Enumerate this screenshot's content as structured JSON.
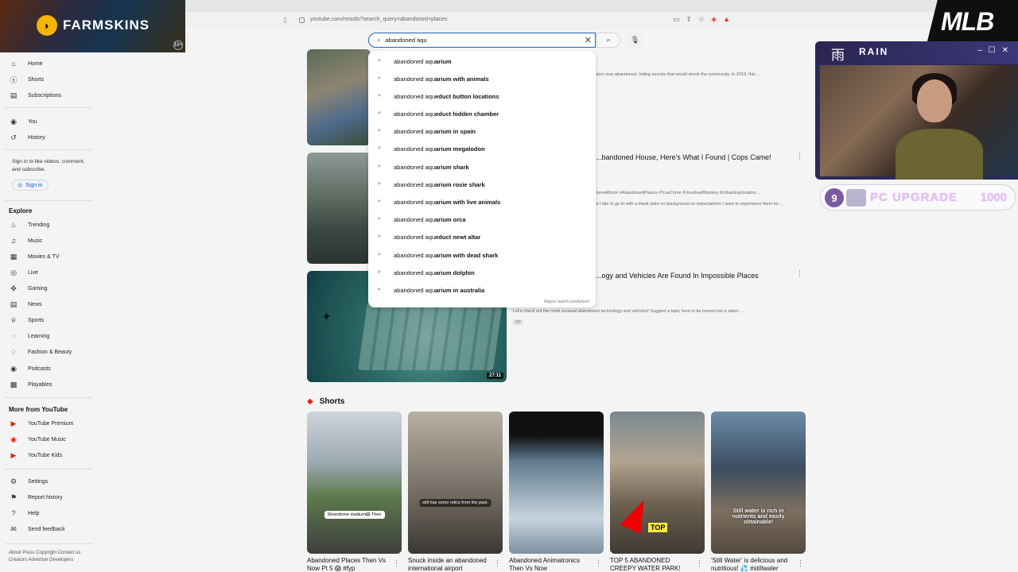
{
  "browser": {
    "url": "youtube.com/results?search_query=abandoned+places"
  },
  "search": {
    "value": "abandoned aqu",
    "suggestions": [
      {
        "prefix": "abandoned aqu",
        "rest": "arium"
      },
      {
        "prefix": "abandoned aqu",
        "rest": "arium with animals"
      },
      {
        "prefix": "abandoned aqu",
        "rest": "educt button locations"
      },
      {
        "prefix": "abandoned aqu",
        "rest": "educt hidden chamber"
      },
      {
        "prefix": "abandoned aqu",
        "rest": "arium in spain"
      },
      {
        "prefix": "abandoned aqu",
        "rest": "arium megalodon"
      },
      {
        "prefix": "abandoned aqu",
        "rest": "arium shark"
      },
      {
        "prefix": "abandoned aqu",
        "rest": "arium rosie shark"
      },
      {
        "prefix": "abandoned aqu",
        "rest": "arium with live animals"
      },
      {
        "prefix": "abandoned aqu",
        "rest": "arium orca"
      },
      {
        "prefix": "abandoned aqu",
        "rest": "educt newt altar"
      },
      {
        "prefix": "abandoned aqu",
        "rest": "arium with dead shark"
      },
      {
        "prefix": "abandoned aqu",
        "rest": "arium dolphin"
      },
      {
        "prefix": "abandoned aqu",
        "rest": "arium in australia"
      }
    ],
    "report_label": "Report search predictions"
  },
  "sidebar": {
    "main": [
      "Home",
      "Shorts",
      "Subscriptions"
    ],
    "you": [
      "You",
      "History"
    ],
    "signin_text": "Sign in to like videos, comment, and subscribe.",
    "signin_button": "Sign in",
    "explore_title": "Explore",
    "explore": [
      "Trending",
      "Music",
      "Movies & TV",
      "Live",
      "Gaming",
      "News",
      "Sports",
      "Learning",
      "Fashion & Beauty",
      "Podcasts",
      "Playables"
    ],
    "more_title": "More from YouTube",
    "more": [
      "YouTube Premium",
      "YouTube Music",
      "YouTube Kids"
    ],
    "settings": [
      "Settings",
      "Report history",
      "Help",
      "Send feedback"
    ],
    "footer": "About  Press  Copyright  Contact us  Creators  Advertise  Developers"
  },
  "results": [
    {
      "title": "",
      "desc": "...sion now abandoned, hiding secrets that would shock the community. In 2018, this ..."
    },
    {
      "title": "...bandoned House, Here's What I Found | Cops Came!",
      "desc": "...lorewithrick #AbandonedPlaces #TrueCrime #UnsolvedMystery #UrbanExploration ...",
      "desc2": "...e I like to go in with a blank slate no background no expectations I want to experience them for ..."
    },
    {
      "title": "...ogy and Vehicles Are Found In Impossible Places",
      "desc": "Let's check out the most unusual abandoned technology and vehicles! Suggest a topic here to be turned into a video: ...",
      "duration": "27:11",
      "badge": "CC"
    }
  ],
  "shorts": {
    "title": "Shorts",
    "items": [
      {
        "title": "Abandoned Places Then Vs Now Pt 5 😱 #fyp",
        "caption": "Silverdome stadium😱 Then"
      },
      {
        "title": "Snuck inside an abandoned international airport",
        "caption": "still has some relics from the past."
      },
      {
        "title": "Abandoned Animatronics Then Vs Now",
        "caption": ""
      },
      {
        "title": "TOP 5 ABANDONED CREEPY WATER PARK!",
        "caption": "TOP"
      },
      {
        "title": "'Still Water' is delicious and nutritious! 💦 #stillwater",
        "caption": "Still water is rich in nutrients and easily obtainable!"
      }
    ]
  },
  "overlays": {
    "farmskins": "FARMSKINS",
    "age": "18+",
    "mlb": "MLB",
    "rain_name": "RAIN",
    "rain_kanji": "雨",
    "upgrade_count": "9",
    "upgrade_label": "PC UPGRADE",
    "upgrade_goal": "1000"
  },
  "colors": {
    "accent": "#065fd4",
    "youtube_red": "#e62117",
    "upgrade_text": "#e8bff5"
  }
}
